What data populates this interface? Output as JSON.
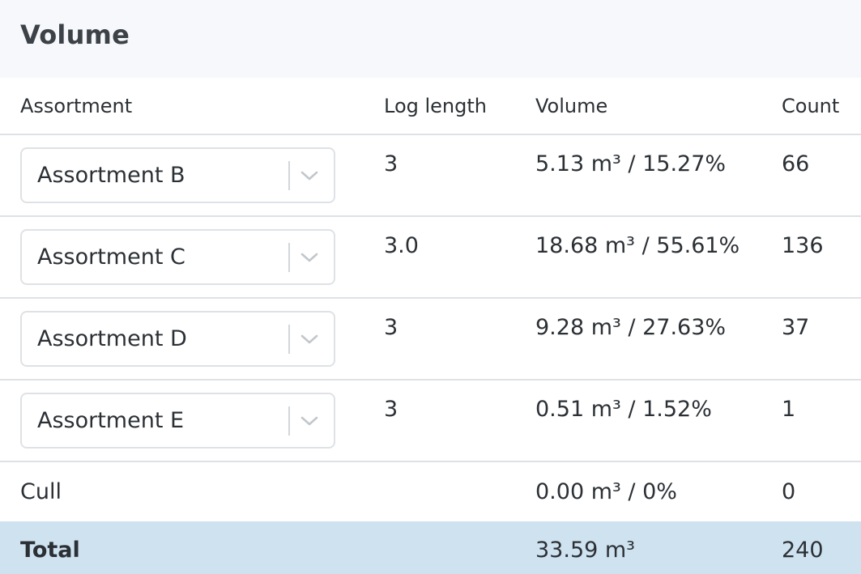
{
  "panel": {
    "title": "Volume"
  },
  "table": {
    "headers": {
      "assortment": "Assortment",
      "log_length": "Log length",
      "volume": "Volume",
      "count": "Count"
    },
    "rows": [
      {
        "assortment": "Assortment B",
        "log_length": "3",
        "volume": "5.13 m³ / 15.27%",
        "count": "66"
      },
      {
        "assortment": "Assortment C",
        "log_length": "3.0",
        "volume": "18.68 m³ / 55.61%",
        "count": "136"
      },
      {
        "assortment": "Assortment D",
        "log_length": "3",
        "volume": "9.28 m³ / 27.63%",
        "count": "37"
      },
      {
        "assortment": "Assortment E",
        "log_length": "3",
        "volume": "0.51 m³ / 1.52%",
        "count": "1"
      }
    ],
    "cull": {
      "label": "Cull",
      "log_length": "",
      "volume": "0.00 m³ / 0%",
      "count": "0"
    },
    "total": {
      "label": "Total",
      "log_length": "",
      "volume": "33.59 m³",
      "count": "240"
    }
  },
  "colors": {
    "header_bg": "#f6f8fb",
    "total_bg": "#cfe2f0",
    "border": "#dee2e6",
    "text": "#2b3035"
  },
  "icons": {
    "select_indicator": "chevron-down-icon"
  }
}
